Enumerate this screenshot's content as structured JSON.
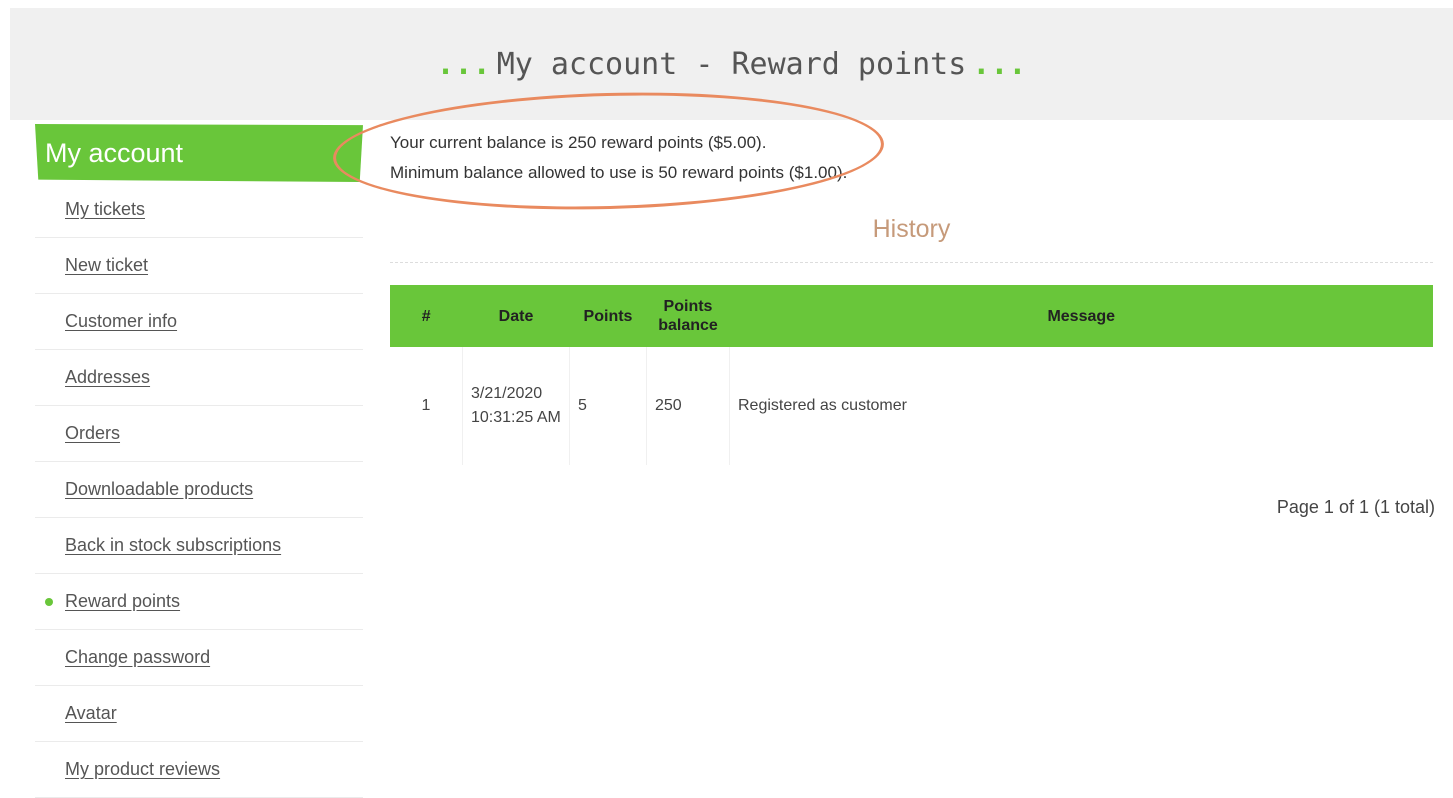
{
  "header": {
    "title": "My account - Reward points"
  },
  "sidebar": {
    "title": "My account",
    "items": [
      {
        "label": "My tickets",
        "active": false
      },
      {
        "label": "New ticket",
        "active": false
      },
      {
        "label": "Customer info",
        "active": false
      },
      {
        "label": "Addresses",
        "active": false
      },
      {
        "label": "Orders",
        "active": false
      },
      {
        "label": "Downloadable products",
        "active": false
      },
      {
        "label": "Back in stock subscriptions",
        "active": false
      },
      {
        "label": "Reward points",
        "active": true
      },
      {
        "label": "Change password",
        "active": false
      },
      {
        "label": "Avatar",
        "active": false
      },
      {
        "label": "My product reviews",
        "active": false
      }
    ]
  },
  "balance": {
    "current": "Your current balance is 250 reward points ($5.00).",
    "minimum": "Minimum balance allowed to use is 50 reward points ($1.00)."
  },
  "history": {
    "title": "History",
    "columns": [
      "#",
      "Date",
      "Points",
      "Points balance",
      "Message"
    ],
    "rows": [
      {
        "num": "1",
        "date": "3/21/2020 10:31:25 AM",
        "points": "5",
        "balance": "250",
        "message": "Registered as customer"
      }
    ]
  },
  "pager": {
    "text": "Page 1 of 1 (1 total)"
  },
  "colors": {
    "accent": "#69c63a",
    "highlight": "#e98a5f",
    "history_title": "#c69a7a"
  }
}
